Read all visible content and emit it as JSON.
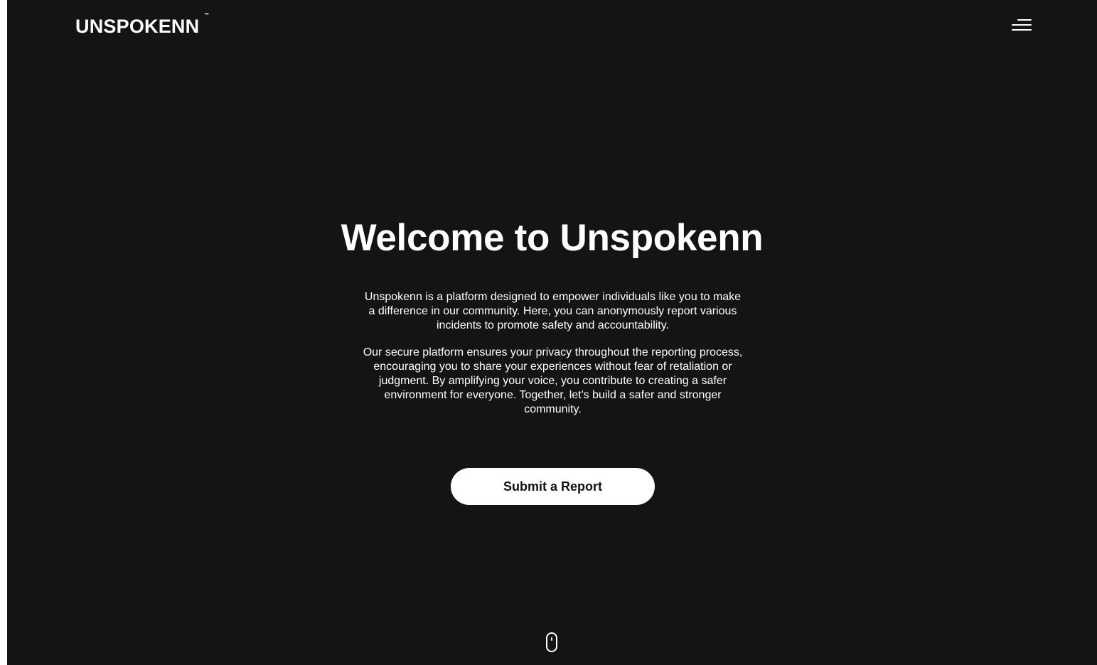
{
  "header": {
    "logo_text": "UNSPOKENN",
    "logo_mark": "™",
    "menu_icon": "hamburger-menu-icon"
  },
  "hero": {
    "title": "Welcome to Unspokenn",
    "paragraph_1": "Unspokenn is a platform designed to empower individuals like you to make a difference in our community. Here, you can anonymously report various incidents to promote safety and accountability.",
    "paragraph_2": "Our secure platform ensures your privacy throughout the reporting process, encouraging you to share your experiences without fear of retaliation or judgment. By amplifying your voice, you contribute to creating a safer environment for everyone. Together, let's build a safer and stronger community.",
    "cta_label": "Submit a Report",
    "scroll_icon": "mouse-scroll-icon"
  },
  "colors": {
    "background": "#141414",
    "text": "#ffffff",
    "button_bg": "#ffffff",
    "button_text": "#111111"
  }
}
